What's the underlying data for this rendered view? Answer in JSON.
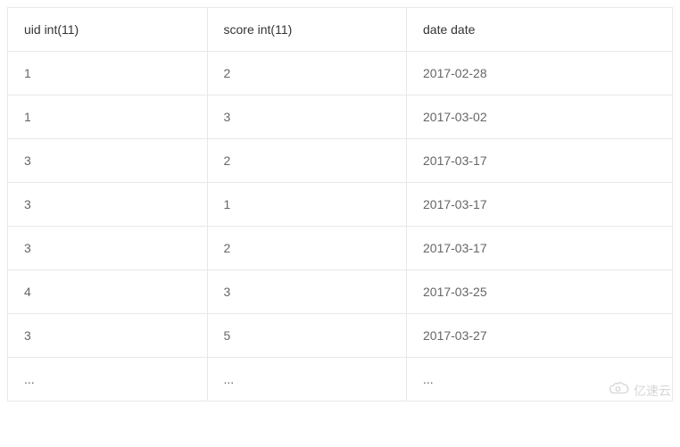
{
  "table": {
    "headers": [
      "uid int(11)",
      "score int(11)",
      "date date"
    ],
    "rows": [
      [
        "1",
        "2",
        "2017-02-28"
      ],
      [
        "1",
        "3",
        "2017-03-02"
      ],
      [
        "3",
        "2",
        "2017-03-17"
      ],
      [
        "3",
        "1",
        "2017-03-17"
      ],
      [
        "3",
        "2",
        "2017-03-17"
      ],
      [
        "4",
        "3",
        "2017-03-25"
      ],
      [
        "3",
        "5",
        "2017-03-27"
      ],
      [
        "...",
        "...",
        "..."
      ]
    ]
  },
  "watermark": {
    "text": "亿速云"
  }
}
